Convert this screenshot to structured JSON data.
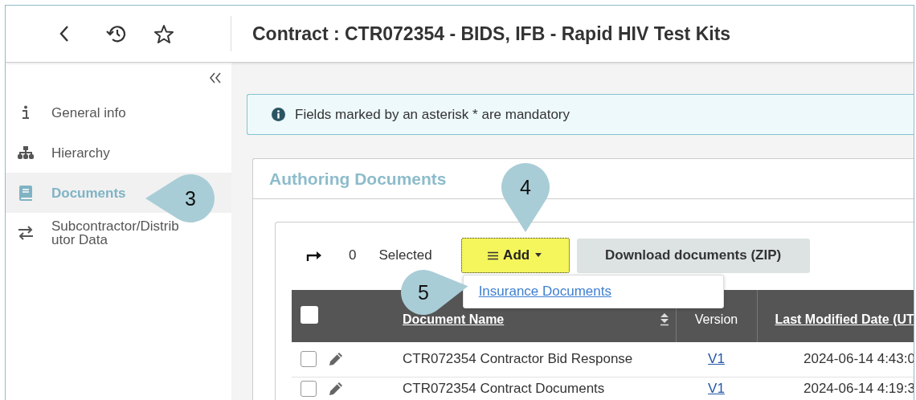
{
  "header": {
    "title": "Contract : CTR072354 - BIDS, IFB - Rapid HIV Test Kits"
  },
  "sidebar": {
    "items": [
      {
        "label": "General info",
        "kind": "info",
        "selected": false
      },
      {
        "label": "Hierarchy",
        "kind": "hierarchy",
        "selected": false
      },
      {
        "label": "Documents",
        "kind": "documents",
        "selected": true
      },
      {
        "label": "Subcontractor/Distributor Data",
        "kind": "swap",
        "selected": false
      }
    ]
  },
  "banner": {
    "text": "Fields marked by an asterisk * are mandatory"
  },
  "section": {
    "title": "Authoring Documents",
    "selection": {
      "count": "0",
      "label": "Selected"
    },
    "add_button": {
      "label": "Add",
      "focused": true
    },
    "download_button": {
      "label": "Download documents (ZIP)"
    },
    "add_menu": {
      "items": [
        {
          "label": "Insurance Documents"
        }
      ]
    },
    "table": {
      "all_checked": false,
      "columns": [
        {
          "label": "Document Name",
          "link": true,
          "sort_icon": true
        },
        {
          "label": "Version",
          "link": false,
          "sort_icon": false
        },
        {
          "label": "Last Modified Date (UT",
          "link": true,
          "sort_icon": false
        }
      ],
      "rows": [
        {
          "name": "CTR072354 Contractor Bid Response",
          "version": "V1",
          "modified": "2024-06-14 4:43:0",
          "checked": false
        },
        {
          "name": "CTR072354 Contract Documents",
          "version": "V1",
          "modified": "2024-06-14 4:19:3",
          "checked": false
        }
      ]
    }
  },
  "callouts": [
    {
      "number": "3"
    },
    {
      "number": "4"
    },
    {
      "number": "5"
    }
  ]
}
